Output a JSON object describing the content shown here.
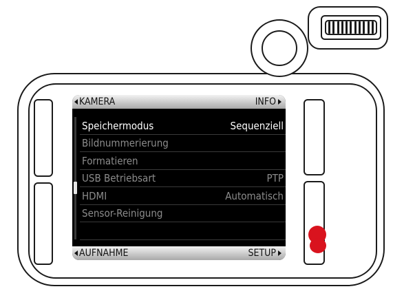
{
  "screen": {
    "top_bar": {
      "left": "KAMERA",
      "right": "INFO"
    },
    "bottom_bar": {
      "left": "AUFNAHME",
      "right": "SETUP"
    },
    "menu_items": [
      {
        "label": "Speichermodus",
        "value": "Sequenziell",
        "active": true
      },
      {
        "label": "Bildnummerierung",
        "value": ""
      },
      {
        "label": "Formatieren",
        "value": ""
      },
      {
        "label": "USB Betriebsart",
        "value": "PTP"
      },
      {
        "label": "HDMI",
        "value": "Automatisch"
      },
      {
        "label": "Sensor-Reinigung",
        "value": ""
      }
    ]
  },
  "colors": {
    "screen_bg": "#000000",
    "bar_gradient_top": "#f2f2f2",
    "bar_gradient_bottom": "#a9a9a9",
    "led": "#d9131e",
    "inactive_text": "#8c8c8c"
  },
  "icons": {
    "left_arrow": "triangle-left-icon",
    "right_arrow": "triangle-right-icon"
  }
}
